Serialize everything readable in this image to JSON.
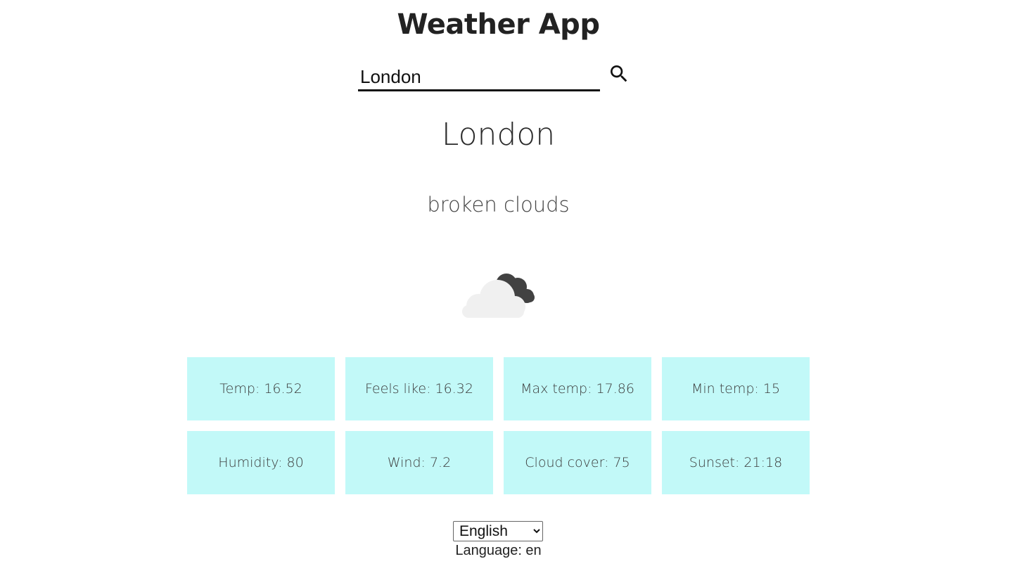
{
  "app": {
    "title": "Weather App"
  },
  "search": {
    "value": "London",
    "icon": "search-icon"
  },
  "weather": {
    "city": "London",
    "description": "broken clouds",
    "icon": "broken-clouds-icon"
  },
  "stats": [
    {
      "label": "Temp: 16.52"
    },
    {
      "label": "Feels like: 16.32"
    },
    {
      "label": "Max temp: 17.86"
    },
    {
      "label": "Min temp: 15"
    },
    {
      "label": "Humidity: 80"
    },
    {
      "label": "Wind: 7.2"
    },
    {
      "label": "Cloud cover: 75"
    },
    {
      "label": "Sunset: 21:18"
    }
  ],
  "language": {
    "selected": "English",
    "label": "Language: en"
  },
  "colors": {
    "card_background": "#c2f9f8",
    "text": "#222222",
    "cloud_light": "#f0f0f0",
    "cloud_dark": "#424242"
  }
}
